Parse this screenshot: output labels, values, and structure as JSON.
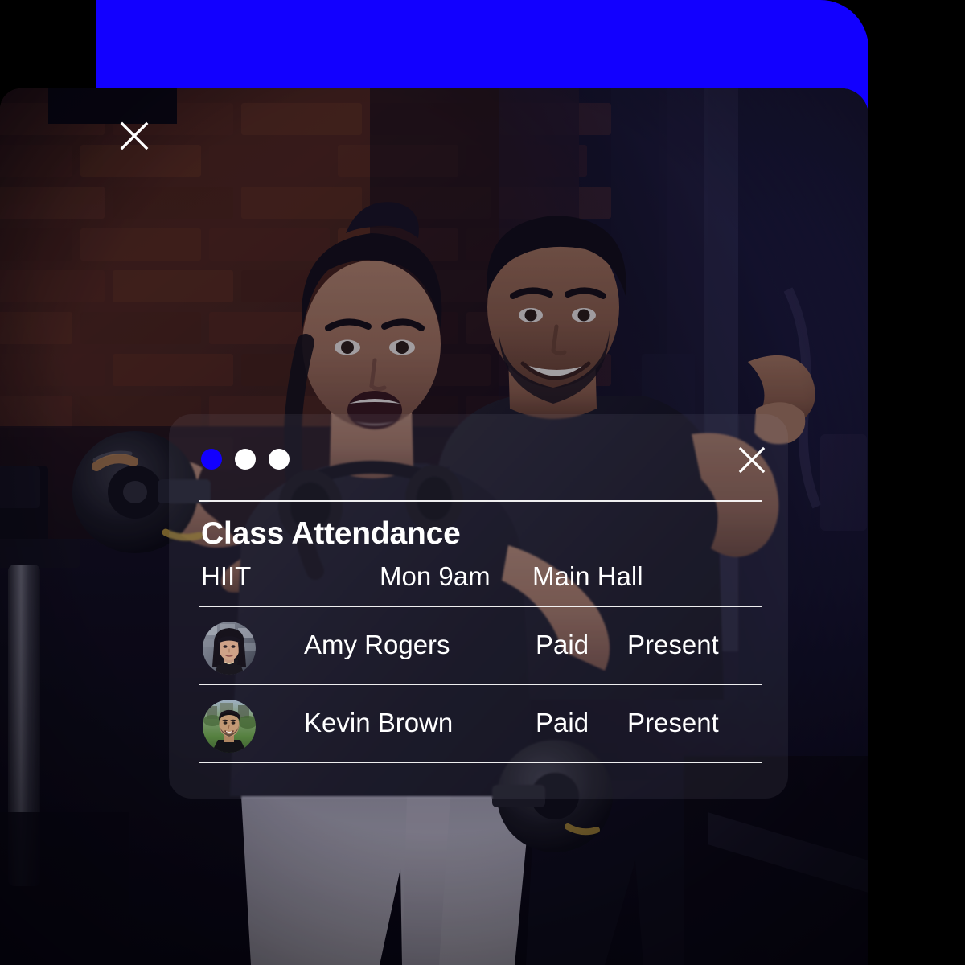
{
  "theme": {
    "accent_blue": "#1200ff",
    "text_color": "#ffffff",
    "panel_bg": "#000000"
  },
  "photo": {
    "alt": "Two people training in a gym with exposed brick wall; a woman lifting a dumbbell and a man flexing behind her",
    "scene": "gym-brick-wall-workout"
  },
  "photo_close": {
    "icon": "close-icon",
    "label": "Close"
  },
  "card": {
    "close": {
      "icon": "close-icon",
      "label": "Close"
    },
    "pager": {
      "count": 3,
      "active_index": 0,
      "dots": [
        {
          "state": "active"
        },
        {
          "state": "inactive"
        },
        {
          "state": "inactive"
        }
      ]
    },
    "title": "Class Attendance",
    "meta": {
      "class_name": "HIIT",
      "schedule": "Mon 9am",
      "location": "Main Hall"
    },
    "attendees": [
      {
        "name": "Amy Rogers",
        "payment": "Paid",
        "attendance": "Present",
        "avatar": "avatar-amy-rogers"
      },
      {
        "name": "Kevin Brown",
        "payment": "Paid",
        "attendance": "Present",
        "avatar": "avatar-kevin-brown"
      }
    ]
  }
}
